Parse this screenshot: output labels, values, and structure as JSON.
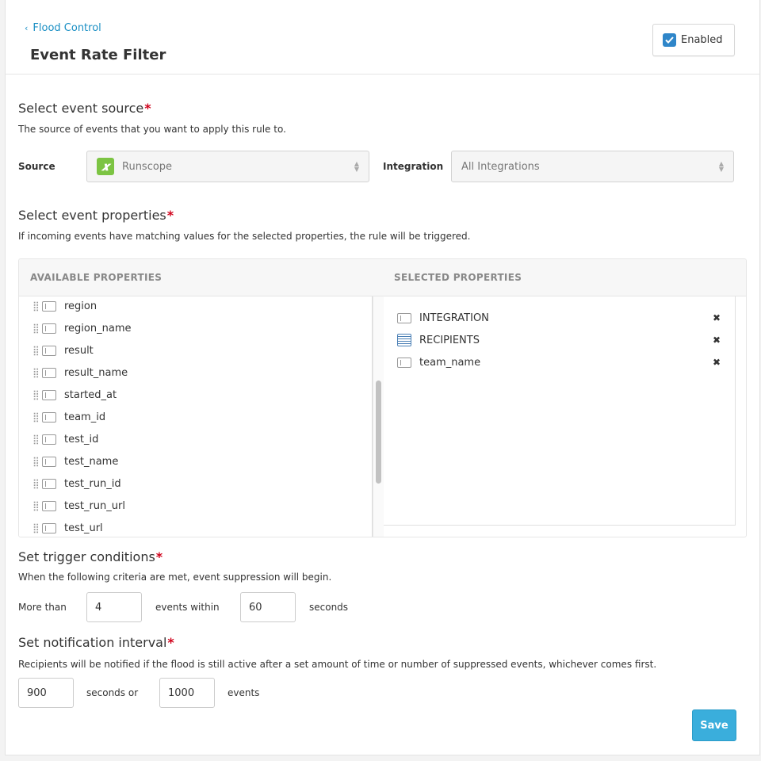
{
  "header": {
    "back_link": "Flood Control",
    "title": "Event Rate Filter",
    "enabled_label": "Enabled"
  },
  "source_section": {
    "title": "Select event source",
    "description": "The source of events that you want to apply this rule to.",
    "source_label": "Source",
    "source_value": "Runscope",
    "integration_label": "Integration",
    "integration_value": "All Integrations"
  },
  "properties_section": {
    "title": "Select event properties",
    "description": "If incoming events have matching values for the selected properties, the rule will be triggered.",
    "available_header": "AVAILABLE PROPERTIES",
    "selected_header": "SELECTED PROPERTIES",
    "available": [
      "region",
      "region_name",
      "result",
      "result_name",
      "started_at",
      "team_id",
      "test_id",
      "test_name",
      "test_run_id",
      "test_run_url",
      "test_url"
    ],
    "selected": [
      {
        "label": "INTEGRATION",
        "icon": "field-icon"
      },
      {
        "label": "RECIPIENTS",
        "icon": "list-icon"
      },
      {
        "label": "team_name",
        "icon": "field-icon"
      }
    ],
    "remove_glyph": "✖"
  },
  "trigger_section": {
    "title": "Set trigger conditions",
    "description": "When the following criteria are met, event suppression will begin.",
    "more_than_label": "More than",
    "events_value": "4",
    "events_within_label": "events within",
    "seconds_value": "60",
    "seconds_label": "seconds"
  },
  "notification_section": {
    "title": "Set notification interval",
    "description": "Recipients will be notified if the flood is still active after a set amount of time or number of suppressed events, whichever comes first.",
    "seconds_value": "900",
    "seconds_or_label": "seconds or",
    "events_value": "1000",
    "events_label": "events"
  },
  "save_label": "Save",
  "colors": {
    "accent": "#1a8fc4",
    "required": "#d0021b",
    "save": "#3aaedc",
    "checkbox": "#2f86c9",
    "runscope": "#7cc443"
  }
}
